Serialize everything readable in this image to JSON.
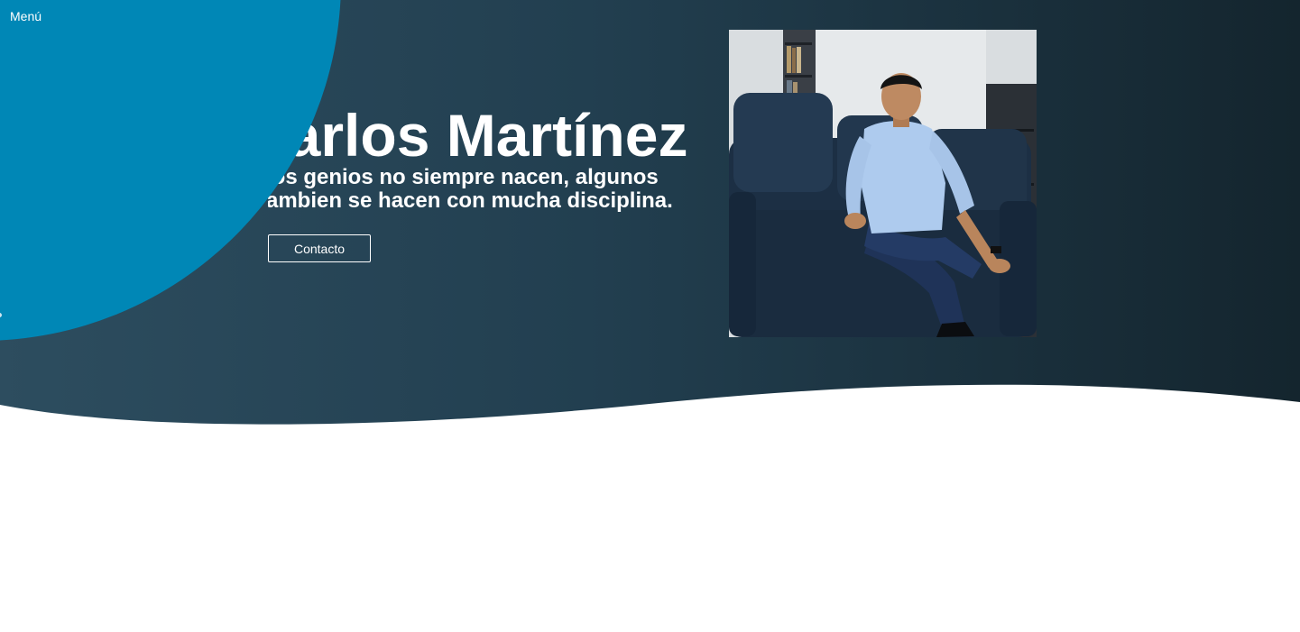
{
  "nav": {
    "menu_label": "Menú"
  },
  "hero": {
    "title": "Carlos Martínez",
    "subtitle_lines": [
      "Los genios no siempre nacen, algunos",
      "tambien se hacen con mucha disciplina."
    ],
    "contact_label": "Contacto"
  },
  "colors": {
    "hero_gradient_start": "#2d4d5f",
    "hero_gradient_end": "#14252e",
    "accent_blob": "#0087b6",
    "text": "#ffffff"
  },
  "photo": {
    "icon": "profile-photo"
  }
}
